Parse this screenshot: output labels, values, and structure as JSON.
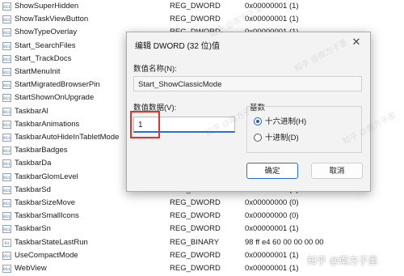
{
  "registry_rows": [
    {
      "name": "ShowSuperHidden",
      "type": "REG_DWORD",
      "data": "0x00000001 (1)"
    },
    {
      "name": "ShowTaskViewButton",
      "type": "REG_DWORD",
      "data": "0x00000001 (1)"
    },
    {
      "name": "ShowTypeOverlay",
      "type": "REG_DWORD",
      "data": "0x00000001 (1)"
    },
    {
      "name": "Start_SearchFiles",
      "type": "",
      "data": ""
    },
    {
      "name": "Start_TrackDocs",
      "type": "",
      "data": ""
    },
    {
      "name": "StartMenuInit",
      "type": "",
      "data": ""
    },
    {
      "name": "StartMigratedBrowserPin",
      "type": "",
      "data": ""
    },
    {
      "name": "StartShownOnUpgrade",
      "type": "",
      "data": ""
    },
    {
      "name": "TaskbarAl",
      "type": "",
      "data": ""
    },
    {
      "name": "TaskbarAnimations",
      "type": "",
      "data": ""
    },
    {
      "name": "TaskbarAutoHideInTabletMode",
      "type": "",
      "data": ""
    },
    {
      "name": "TaskbarBadges",
      "type": "",
      "data": ""
    },
    {
      "name": "TaskbarDa",
      "type": "",
      "data": ""
    },
    {
      "name": "TaskbarGlomLevel",
      "type": "",
      "data": ""
    },
    {
      "name": "TaskbarSd",
      "type": "REG_DWORD",
      "data": "0x00000001 (1)"
    },
    {
      "name": "TaskbarSizeMove",
      "type": "REG_DWORD",
      "data": "0x00000000 (0)"
    },
    {
      "name": "TaskbarSmallIcons",
      "type": "REG_DWORD",
      "data": "0x00000000 (0)"
    },
    {
      "name": "TaskbarSn",
      "type": "REG_DWORD",
      "data": "0x00000001 (1)"
    },
    {
      "name": "TaskbarStateLastRun",
      "type": "REG_BINARY",
      "data": "98 ff e4 60 00 00 00 00"
    },
    {
      "name": "UseCompactMode",
      "type": "REG_DWORD",
      "data": "0x00000001 (1)"
    },
    {
      "name": "WebView",
      "type": "REG_DWORD",
      "data": "0x00000001 (1)"
    }
  ],
  "dialog": {
    "title": "编辑 DWORD (32 位)值",
    "close_glyph": "✕",
    "value_name_label": "数值名称(N):",
    "value_name": "Start_ShowClassicMode",
    "value_data_label": "数值数据(V):",
    "value_data": "1",
    "base_label": "基数",
    "radio_hex": "十六进制(H)",
    "radio_dec": "十进制(D)",
    "selected_base": "hex",
    "ok_label": "确定",
    "cancel_label": "取消"
  },
  "watermark": {
    "badge": "知乎 @南方子墨",
    "text_1": "知乎 @南方子墨",
    "text_2": "知乎 @南方子墨",
    "text_3": "知乎 @南方子墨",
    "text_4": "知乎 @南方子墨"
  },
  "colors": {
    "accent": "#2a6fd4",
    "highlight": "#e03131",
    "icon_blue": "#3b6fb6"
  }
}
